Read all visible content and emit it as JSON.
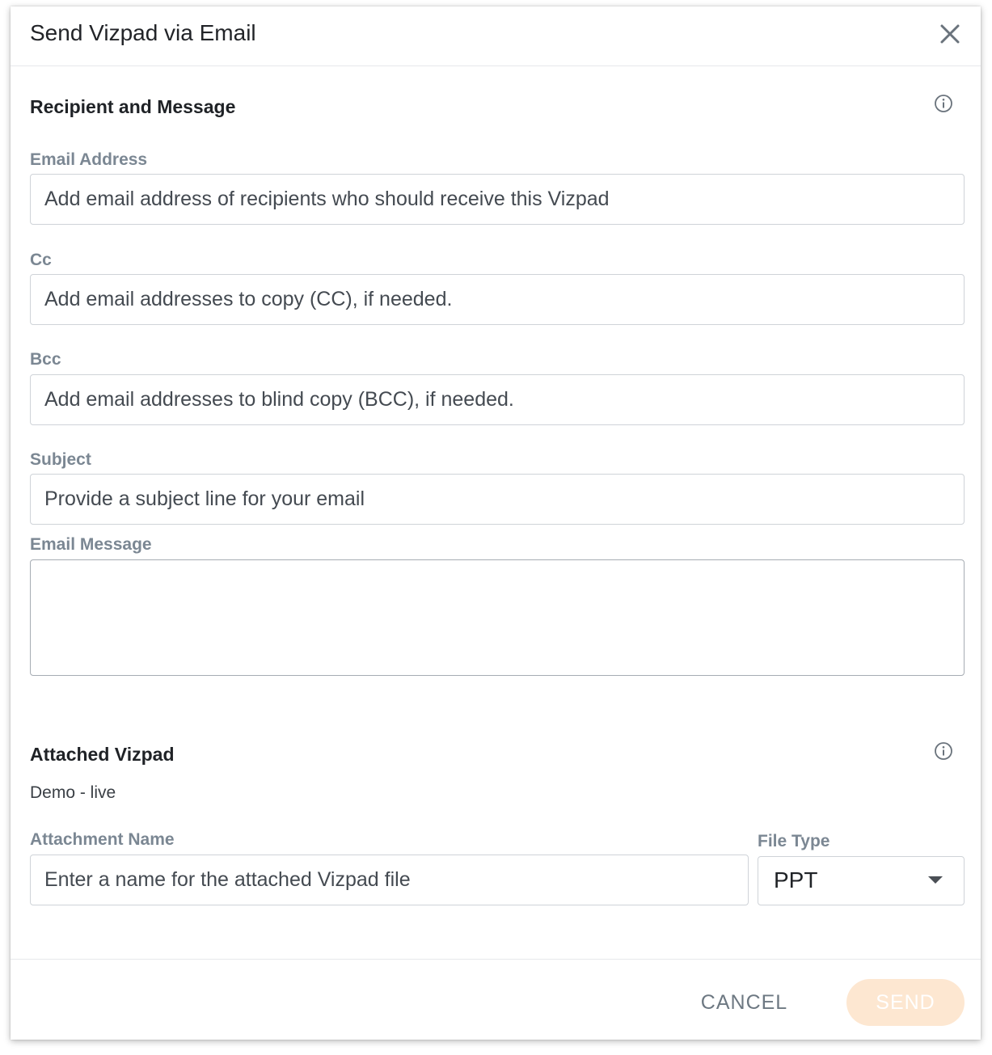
{
  "dialog": {
    "title": "Send Vizpad via Email"
  },
  "recipient_section": {
    "title": "Recipient and Message",
    "email": {
      "label": "Email Address",
      "value": "",
      "placeholder": "Add email address of recipients who should receive this Vizpad"
    },
    "cc": {
      "label": "Cc",
      "value": "",
      "placeholder": "Add email addresses to copy (CC), if needed."
    },
    "bcc": {
      "label": "Bcc",
      "value": "",
      "placeholder": "Add email addresses to blind copy (BCC), if needed."
    },
    "subject": {
      "label": "Subject",
      "value": "",
      "placeholder": "Provide a subject line for your email"
    },
    "message": {
      "label": "Email Message",
      "value": ""
    }
  },
  "attachment_section": {
    "title": "Attached Vizpad",
    "vizpad_name": "Demo - live",
    "attachment_name": {
      "label": "Attachment Name",
      "value": "",
      "placeholder": "Enter a name for the attached Vizpad file"
    },
    "file_type": {
      "label": "File Type",
      "selected": "PPT"
    }
  },
  "footer": {
    "cancel_label": "CANCEL",
    "send_label": "SEND"
  },
  "icons": {
    "close": "close-icon",
    "info": "info-icon",
    "dropdown": "caret-down-icon"
  },
  "colors": {
    "send_disabled_bg": "#fde7d1",
    "label": "#7b8793",
    "cancel": "#6d7882"
  }
}
